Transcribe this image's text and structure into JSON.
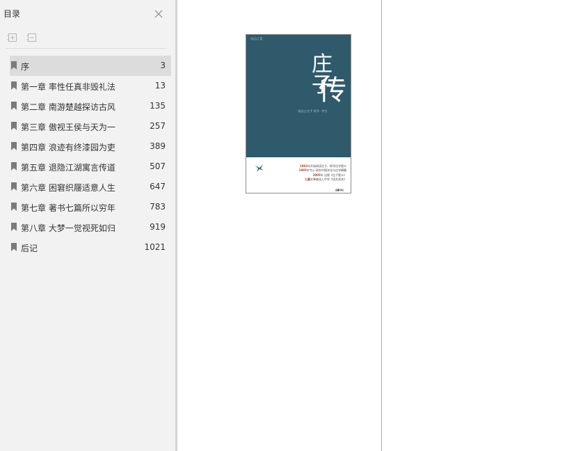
{
  "sidebar": {
    "title": "目录",
    "items": [
      {
        "label": "序",
        "page": "3",
        "selected": true
      },
      {
        "label": "第一章 率性任真非毁礼法",
        "page": "13"
      },
      {
        "label": "第二章 南游楚越探访古风",
        "page": "135"
      },
      {
        "label": "第三章 傲视王侯与天为一",
        "page": "257"
      },
      {
        "label": "第四章 浪迹有终漆园为吏",
        "page": "389"
      },
      {
        "label": "第五章 退隐江湖寓言传道",
        "page": "507"
      },
      {
        "label": "第六章 困窘织屦适意人生",
        "page": "647"
      },
      {
        "label": "第七章 著书七篇所以穷年",
        "page": "783"
      },
      {
        "label": "第八章 大梦一觉视死如归",
        "page": "919"
      },
      {
        "label": "后记",
        "page": "1021"
      }
    ]
  },
  "cover": {
    "author": "张远山 著",
    "title_line1": "庄子",
    "title_line2": "传",
    "subtitle": "张远山 庄子 系列 · 传记",
    "blurb": [
      {
        "num": "1992",
        "text": "年开始研读庄子，探寻庄学奥义"
      },
      {
        "num": "1995",
        "text": "年专心 研究中国文化与庄学精髓"
      },
      {
        "num": "2005",
        "text": "年 出版《庄子奥义》"
      },
      {
        "num": "九篇",
        "text": "文章被选入中学《语文读本》"
      }
    ],
    "publisher": "岳麓书社"
  },
  "colors": {
    "sidebar_bg": "#f2f2f2",
    "selected_bg": "#dcdcdc",
    "cover_teal": "#2f5a6b",
    "accent_red": "#b2442a"
  }
}
